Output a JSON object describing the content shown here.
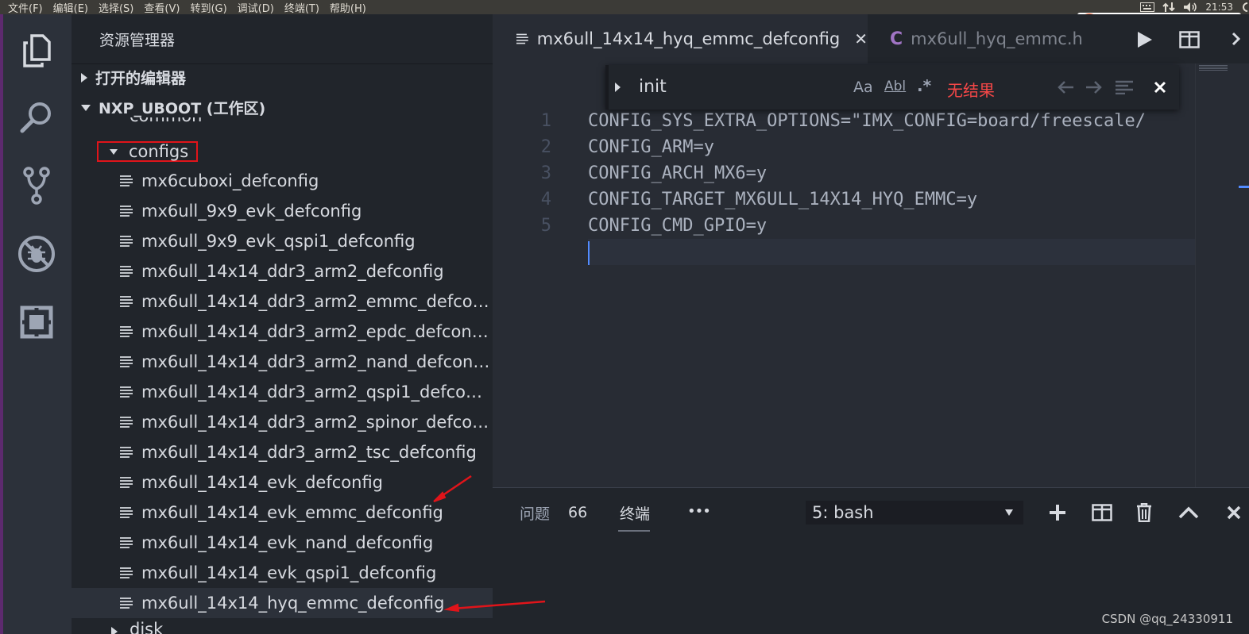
{
  "system_menu": [
    "文件(F)",
    "编辑(E)",
    "选择(S)",
    "查看(V)",
    "转到(G)",
    "调试(D)",
    "终端(T)",
    "帮助(H)"
  ],
  "tray": {
    "time": "21:53",
    "ime_label": "中"
  },
  "sidebar": {
    "title": "资源管理器",
    "open_editors": "打开的编辑器",
    "workspace": "NXP_UBOOT (工作区)",
    "partial_folder_top": "common",
    "highlighted_folder": "configs",
    "files": [
      "mx6cuboxi_defconfig",
      "mx6ull_9x9_evk_defconfig",
      "mx6ull_9x9_evk_qspi1_defconfig",
      "mx6ull_14x14_ddr3_arm2_defconfig",
      "mx6ull_14x14_ddr3_arm2_emmc_defcon...",
      "mx6ull_14x14_ddr3_arm2_epdc_defconfig",
      "mx6ull_14x14_ddr3_arm2_nand_defconfig",
      "mx6ull_14x14_ddr3_arm2_qspi1_defconfig",
      "mx6ull_14x14_ddr3_arm2_spinor_defcon...",
      "mx6ull_14x14_ddr3_arm2_tsc_defconfig",
      "mx6ull_14x14_evk_defconfig",
      "mx6ull_14x14_evk_emmc_defconfig",
      "mx6ull_14x14_evk_nand_defconfig",
      "mx6ull_14x14_evk_qspi1_defconfig",
      "mx6ull_14x14_hyq_emmc_defconfig"
    ],
    "partial_folder_bottom": "disk"
  },
  "tabs": {
    "active": "mx6ull_14x14_hyq_emmc_defconfig",
    "close_glyph": "✕",
    "inactive": "mx6ull_hyq_emmc.h",
    "inactive_icon": "C"
  },
  "find": {
    "value": "init",
    "match_case": "Aa",
    "whole_word": "Abl",
    "regex": ".*",
    "result": "无结果"
  },
  "code": [
    {
      "n": "1",
      "text": "CONFIG_SYS_EXTRA_OPTIONS=\"IMX_CONFIG=board/freescale/"
    },
    {
      "n": "2",
      "text": "CONFIG_ARM=y"
    },
    {
      "n": "3",
      "text": "CONFIG_ARCH_MX6=y"
    },
    {
      "n": "4",
      "text": "CONFIG_TARGET_MX6ULL_14X14_HYQ_EMMC=y"
    },
    {
      "n": "5",
      "text": "CONFIG_CMD_GPIO=y"
    }
  ],
  "panel": {
    "problems_label": "问题",
    "problems_count": "66",
    "terminal_label": "终端",
    "more": "•••",
    "terminal_select": "5: bash"
  },
  "watermark": "CSDN @qq_24330911",
  "colors": {
    "annotation_red": "#e0141a",
    "accent_blue": "#528bff",
    "c_icon": "#a074c4",
    "find_result": "#f44747"
  }
}
